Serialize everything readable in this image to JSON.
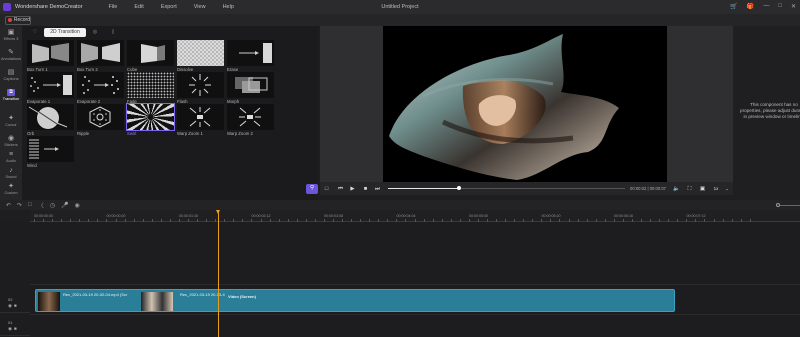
{
  "app": {
    "name": "Wondershare DemoCreator",
    "project_title": "Untitled Project"
  },
  "menu": [
    "File",
    "Edit",
    "Export",
    "View",
    "Help"
  ],
  "record": {
    "label": "Record"
  },
  "sidebar": [
    {
      "label": "Effects 3",
      "icon": "effects-icon"
    },
    {
      "label": "Annotations",
      "icon": "annotation-icon"
    },
    {
      "label": "Captions",
      "icon": "caption-icon"
    },
    {
      "label": "Transition",
      "icon": "transition-icon"
    },
    {
      "label": "Cursor",
      "icon": "cursor-icon"
    },
    {
      "label": "Stickers",
      "icon": "sticker-icon"
    },
    {
      "label": "Audio",
      "icon": "audio-icon"
    },
    {
      "label": "Sound",
      "icon": "sound-icon"
    },
    {
      "label": "Custom",
      "icon": "custom-icon"
    }
  ],
  "library": {
    "tabs": [
      "",
      "2D Transition",
      "",
      ""
    ],
    "tiles": [
      "Box Turn 1",
      "Box Turn 2",
      "Cube",
      "Dissolve",
      "Erase",
      "Evaporate 1",
      "Evaporate 2",
      "Fade",
      "Flash",
      "Morph",
      "Orb",
      "Ripple",
      "Swirl",
      "Warp Zoom 1",
      "Warp Zoom 2",
      "Wind"
    ],
    "selected_index": 12
  },
  "player": {
    "time": "00:00:02 | 00:00:07",
    "speed": "1x",
    "progress": 0.3
  },
  "properties": {
    "message": "This component has no properties, please adjust duration in preview window or timeline."
  },
  "timeline": {
    "ruler": [
      "00:00:00:00",
      "00:00:00:20",
      "00:00:01:16",
      "00:00:02:12",
      "00:00:03:08",
      "00:00:04:04",
      "00:00:05:00",
      "00:00:05:20",
      "00:00:06:16",
      "00:00:07:12"
    ],
    "tracks": [
      {
        "num": "02"
      },
      {
        "num": "01"
      }
    ],
    "clip": {
      "label_a": "Rec_2021-03-19 20-02-04.mp4 (Scr",
      "label_b": "Rec_2021-03-19 20-03-4",
      "label_c": "Video (Screen)"
    }
  }
}
